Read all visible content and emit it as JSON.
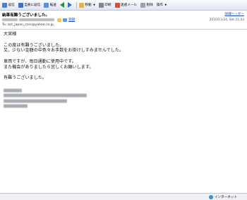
{
  "toolbar": {
    "reply": "返信",
    "reply_all": "全員に返信",
    "forward": "転送",
    "move": "移動",
    "print": "印刷",
    "spam": "迷惑メール",
    "delete": "削除",
    "actions": "操作"
  },
  "header": {
    "subject": "納車有難うございました。",
    "detail_link": "詳細ヘッダー",
    "from_label": "",
    "add_address_link": "登録",
    "to_label": "To:",
    "to_address": "act_japan_cars@yahoo.co.jp",
    "date": "2010/11/24, Sat 21:43"
  },
  "message": {
    "greeting": "大宮様",
    "line1": "この度は有難うございました。",
    "line2": "又、少ない金額の中色々お手数をお掛けしすみませんでした。",
    "line3": "車両ですが、毎日通勤に使用中です。",
    "line4": "また機会がありましたら宜しくお願いします。",
    "closing": "有難うございました。"
  },
  "status": {
    "zone": "インターネット"
  },
  "colors": {
    "toolbar_top": "#fbfcfe",
    "toolbar_bottom": "#dfe6f1",
    "link": "#1a49b8"
  }
}
